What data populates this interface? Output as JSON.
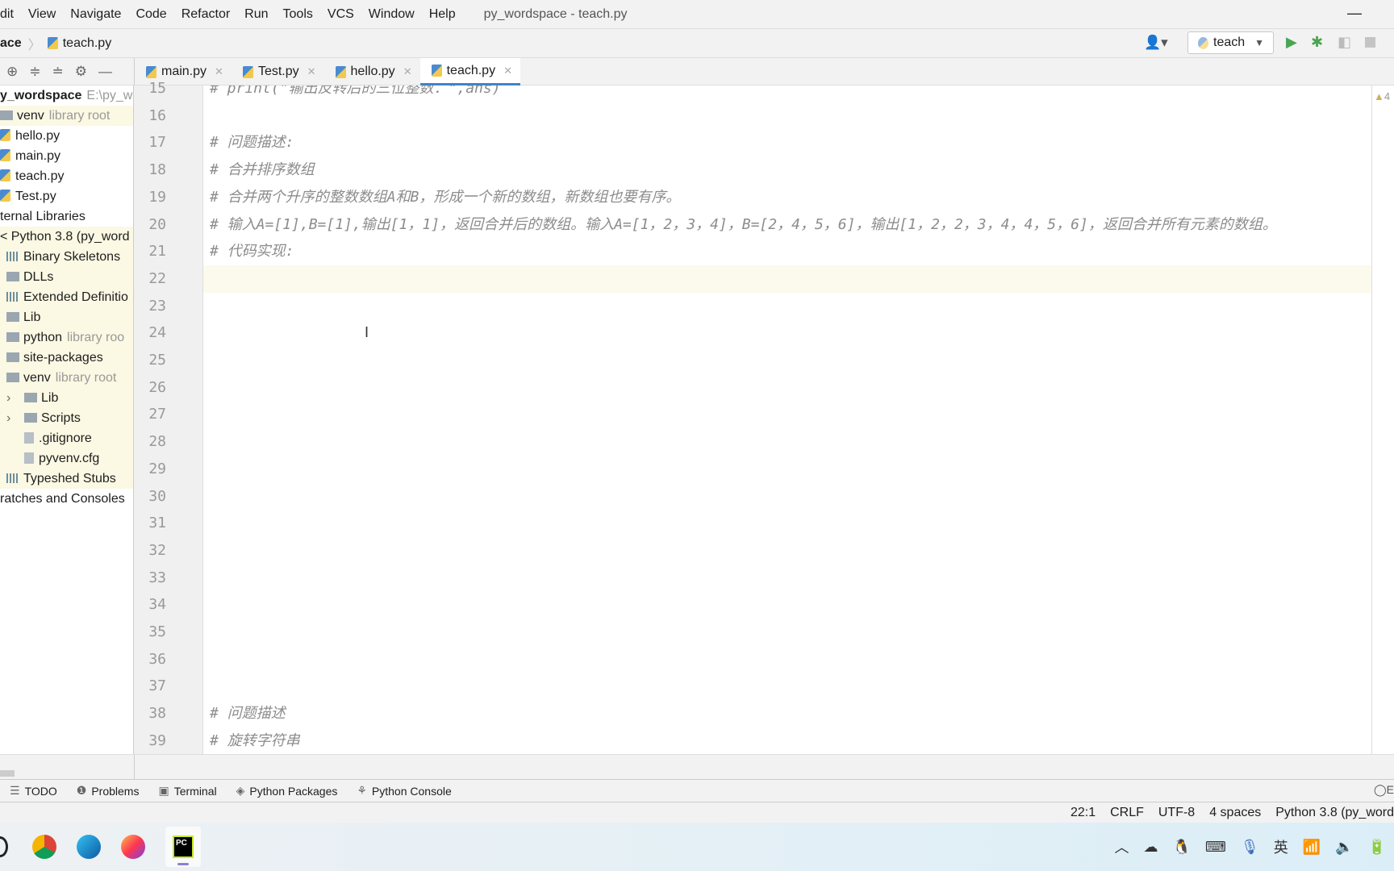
{
  "menu": [
    "dit",
    "View",
    "Navigate",
    "Code",
    "Refactor",
    "Run",
    "Tools",
    "VCS",
    "Window",
    "Help"
  ],
  "window_title": "py_wordspace - teach.py",
  "breadcrumb": {
    "project": "ace",
    "file": "teach.py"
  },
  "run_config": "teach",
  "tabs": [
    {
      "label": "main.py"
    },
    {
      "label": "Test.py"
    },
    {
      "label": "hello.py"
    },
    {
      "label": "teach.py",
      "active": true
    }
  ],
  "project_tree": [
    {
      "label": "y_wordspace",
      "hint": "E:\\py_wo",
      "bold": true,
      "indent": 0,
      "icon": "none"
    },
    {
      "label": "venv",
      "hint": "library root",
      "indent": 0,
      "icon": "folder",
      "hl": true
    },
    {
      "label": "hello.py",
      "indent": 0,
      "icon": "py"
    },
    {
      "label": "main.py",
      "indent": 0,
      "icon": "py"
    },
    {
      "label": "teach.py",
      "indent": 0,
      "icon": "py"
    },
    {
      "label": "Test.py",
      "indent": 0,
      "icon": "py"
    },
    {
      "label": "ternal Libraries",
      "indent": 0,
      "icon": "none"
    },
    {
      "label": "< Python 3.8 (py_word",
      "indent": 0,
      "icon": "none",
      "hl": true
    },
    {
      "label": "Binary Skeletons",
      "indent": 1,
      "icon": "lib",
      "hl": true
    },
    {
      "label": "DLLs",
      "indent": 1,
      "icon": "folder",
      "hl": true
    },
    {
      "label": "Extended Definitio",
      "indent": 1,
      "icon": "lib",
      "hl": true
    },
    {
      "label": "Lib",
      "indent": 1,
      "icon": "folder",
      "hl": true
    },
    {
      "label": "python",
      "hint": "library roo",
      "indent": 1,
      "icon": "folder",
      "hl": true
    },
    {
      "label": "site-packages",
      "indent": 1,
      "icon": "folder",
      "hl": true
    },
    {
      "label": "venv",
      "hint": "library root",
      "indent": 1,
      "icon": "folder",
      "hl": true
    },
    {
      "label": "Lib",
      "indent": 2,
      "icon": "folder",
      "arrow": true,
      "hl": true
    },
    {
      "label": "Scripts",
      "indent": 2,
      "icon": "folder",
      "arrow": true,
      "hl": true
    },
    {
      "label": ".gitignore",
      "indent": 2,
      "icon": "file",
      "hl": true
    },
    {
      "label": "pyvenv.cfg",
      "indent": 2,
      "icon": "file",
      "hl": true
    },
    {
      "label": "Typeshed Stubs",
      "indent": 1,
      "icon": "lib",
      "hl": true
    },
    {
      "label": "ratches and Consoles",
      "indent": 0,
      "icon": "none"
    }
  ],
  "code": {
    "first_line": 15,
    "last_line": 39,
    "caret_line": 22,
    "lines": {
      "15": "#     print(\"输出反转后的三位整数：\",ans)",
      "17": "# 问题描述:",
      "18": "# 合并排序数组",
      "19": "# 合并两个升序的整数数组A和B，形成一个新的数组，新数组也要有序。",
      "20": "# 输入A=[1],B=[1],输出[1，1]，返回合并后的数组。输入A=[1，2，3，4]，B=[2，4，5，6]，输出[1，2，2，3，4，4，5，6]，返回合并所有元素的数组。",
      "21": "# 代码实现:",
      "38": "# 问题描述",
      "39": "# 旋转字符串"
    }
  },
  "warnings_count": "4",
  "tool_windows": [
    "TODO",
    "Problems",
    "Terminal",
    "Python Packages",
    "Python Console"
  ],
  "status": {
    "position": "22:1",
    "line_sep": "CRLF",
    "encoding": "UTF-8",
    "indent": "4 spaces",
    "interpreter": "Python 3.8 (py_word"
  },
  "tray": {
    "ime": "英"
  },
  "colors": {
    "accent": "#4083c9",
    "run": "#4aa552",
    "highlight": "#fbf8e3"
  }
}
